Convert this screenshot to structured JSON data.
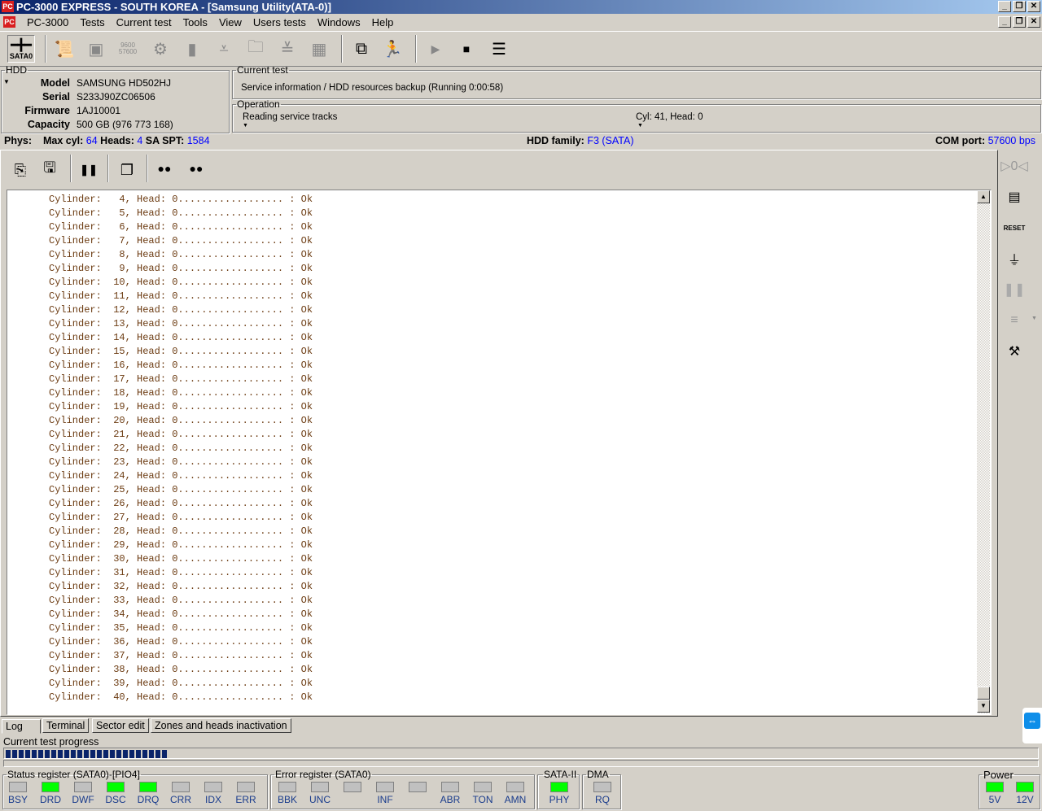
{
  "window": {
    "title": "PC-3000 EXPRESS - SOUTH KOREA - [Samsung Utility(ATA-0)]",
    "app_icon": "pc3000-logo-icon"
  },
  "menu": [
    "PC-3000",
    "Tests",
    "Current test",
    "Tools",
    "View",
    "Users tests",
    "Windows",
    "Help"
  ],
  "toolbar": {
    "port_label": "SATA0",
    "baud_icon_text": "9600 57600"
  },
  "hdd": {
    "legend": "HDD",
    "model_label": "Model",
    "model": "SAMSUNG HD502HJ",
    "serial_label": "Serial",
    "serial": "S233J90ZC06506",
    "firmware_label": "Firmware",
    "firmware": "1AJ10001",
    "capacity_label": "Capacity",
    "capacity": "500 GB (976 773 168)"
  },
  "current_test": {
    "legend": "Current test",
    "text": "Service information / HDD resources backup (Running 0:00:58)"
  },
  "operation": {
    "legend": "Operation",
    "text": "Reading service tracks",
    "position": "Cyl: 41, Head: 0"
  },
  "phys": {
    "label": "Phys:",
    "max_cyl_label": "Max cyl:",
    "max_cyl": "64",
    "heads_label": "Heads:",
    "heads": "4",
    "spt_label": "SA SPT:",
    "spt": "1584",
    "family_label": "HDD family:",
    "family": "F3 (SATA)",
    "com_label": "COM port:",
    "com": "57600 bps"
  },
  "log": {
    "lines": [
      "Cylinder:   4, Head: 0.................. : Ok",
      "Cylinder:   5, Head: 0.................. : Ok",
      "Cylinder:   6, Head: 0.................. : Ok",
      "Cylinder:   7, Head: 0.................. : Ok",
      "Cylinder:   8, Head: 0.................. : Ok",
      "Cylinder:   9, Head: 0.................. : Ok",
      "Cylinder:  10, Head: 0.................. : Ok",
      "Cylinder:  11, Head: 0.................. : Ok",
      "Cylinder:  12, Head: 0.................. : Ok",
      "Cylinder:  13, Head: 0.................. : Ok",
      "Cylinder:  14, Head: 0.................. : Ok",
      "Cylinder:  15, Head: 0.................. : Ok",
      "Cylinder:  16, Head: 0.................. : Ok",
      "Cylinder:  17, Head: 0.................. : Ok",
      "Cylinder:  18, Head: 0.................. : Ok",
      "Cylinder:  19, Head: 0.................. : Ok",
      "Cylinder:  20, Head: 0.................. : Ok",
      "Cylinder:  21, Head: 0.................. : Ok",
      "Cylinder:  22, Head: 0.................. : Ok",
      "Cylinder:  23, Head: 0.................. : Ok",
      "Cylinder:  24, Head: 0.................. : Ok",
      "Cylinder:  25, Head: 0.................. : Ok",
      "Cylinder:  26, Head: 0.................. : Ok",
      "Cylinder:  27, Head: 0.................. : Ok",
      "Cylinder:  28, Head: 0.................. : Ok",
      "Cylinder:  29, Head: 0.................. : Ok",
      "Cylinder:  30, Head: 0.................. : Ok",
      "Cylinder:  31, Head: 0.................. : Ok",
      "Cylinder:  32, Head: 0.................. : Ok",
      "Cylinder:  33, Head: 0.................. : Ok",
      "Cylinder:  34, Head: 0.................. : Ok",
      "Cylinder:  35, Head: 0.................. : Ok",
      "Cylinder:  36, Head: 0.................. : Ok",
      "Cylinder:  37, Head: 0.................. : Ok",
      "Cylinder:  38, Head: 0.................. : Ok",
      "Cylinder:  39, Head: 0.................. : Ok",
      "Cylinder:  40, Head: 0.................. : Ok"
    ]
  },
  "tabs": [
    "Log",
    "Terminal",
    "Sector edit",
    "Zones and heads inactivation"
  ],
  "progress": {
    "label": "Current test progress",
    "percent": 16
  },
  "status_register": {
    "legend": "Status register (SATA0)-[PIO4]",
    "leds": [
      {
        "label": "BSY",
        "on": false
      },
      {
        "label": "DRD",
        "on": true
      },
      {
        "label": "DWF",
        "on": false
      },
      {
        "label": "DSC",
        "on": true
      },
      {
        "label": "DRQ",
        "on": true
      },
      {
        "label": "CRR",
        "on": false
      },
      {
        "label": "IDX",
        "on": false
      },
      {
        "label": "ERR",
        "on": false
      }
    ]
  },
  "error_register": {
    "legend": "Error register (SATA0)",
    "leds": [
      {
        "label": "BBK",
        "on": false
      },
      {
        "label": "UNC",
        "on": false
      },
      {
        "label": "",
        "on": false
      },
      {
        "label": "INF",
        "on": false
      },
      {
        "label": "",
        "on": false
      },
      {
        "label": "ABR",
        "on": false
      },
      {
        "label": "TON",
        "on": false
      },
      {
        "label": "AMN",
        "on": false
      }
    ]
  },
  "sata": {
    "legend": "SATA-II",
    "label": "PHY",
    "on": true
  },
  "dma": {
    "legend": "DMA",
    "label": "RQ",
    "on": false
  },
  "power": {
    "legend": "Power",
    "leds": [
      {
        "label": "5V",
        "on": true
      },
      {
        "label": "12V",
        "on": true
      }
    ]
  },
  "colors": {
    "led_on": "#00ff00",
    "led_off": "#c0c0c0",
    "value_blue": "#0000ff",
    "progress": "#0a246a"
  }
}
